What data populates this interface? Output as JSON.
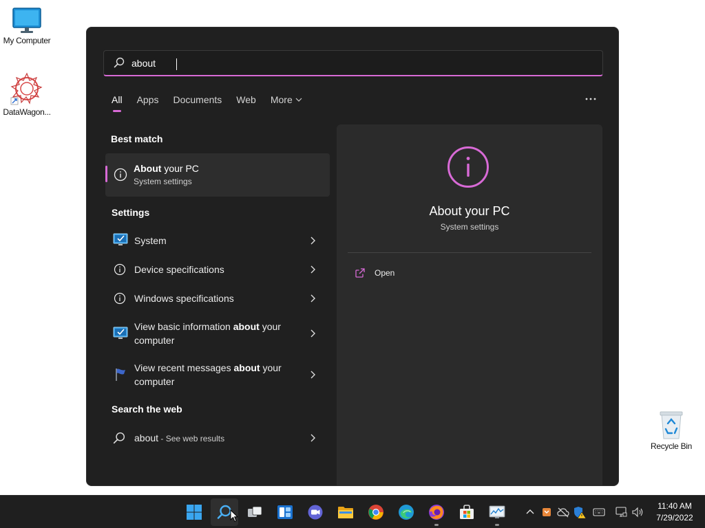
{
  "desktop": {
    "icons": [
      {
        "label": "My Computer"
      },
      {
        "label": "DataWagon..."
      },
      {
        "label": "Recycle Bin"
      }
    ]
  },
  "search": {
    "query": "about"
  },
  "tabs": [
    {
      "label": "All"
    },
    {
      "label": "Apps"
    },
    {
      "label": "Documents"
    },
    {
      "label": "Web"
    },
    {
      "label": "More"
    }
  ],
  "best_match": {
    "heading": "Best match",
    "title_bold": "About",
    "title_rest": " your PC",
    "subtitle": "System settings"
  },
  "settings": {
    "heading": "Settings",
    "items": [
      {
        "label": "System"
      },
      {
        "label": "Device specifications"
      },
      {
        "label": "Windows specifications"
      },
      {
        "pre": "View basic information ",
        "bold": "about",
        "post": " your computer"
      },
      {
        "pre": "View recent messages ",
        "bold": "about",
        "post": " your computer"
      }
    ]
  },
  "web": {
    "heading": "Search the web",
    "query": "about",
    "suffix": " - See web results"
  },
  "preview": {
    "title": "About your PC",
    "subtitle": "System settings",
    "open_label": "Open"
  },
  "clock": {
    "time": "11:40 AM",
    "date": "7/29/2022"
  },
  "colors": {
    "accent": "#d86ad6",
    "panel_bg": "#202020",
    "preview_bg": "#2b2b2b",
    "taskbar_bg": "#1f1f1f"
  }
}
